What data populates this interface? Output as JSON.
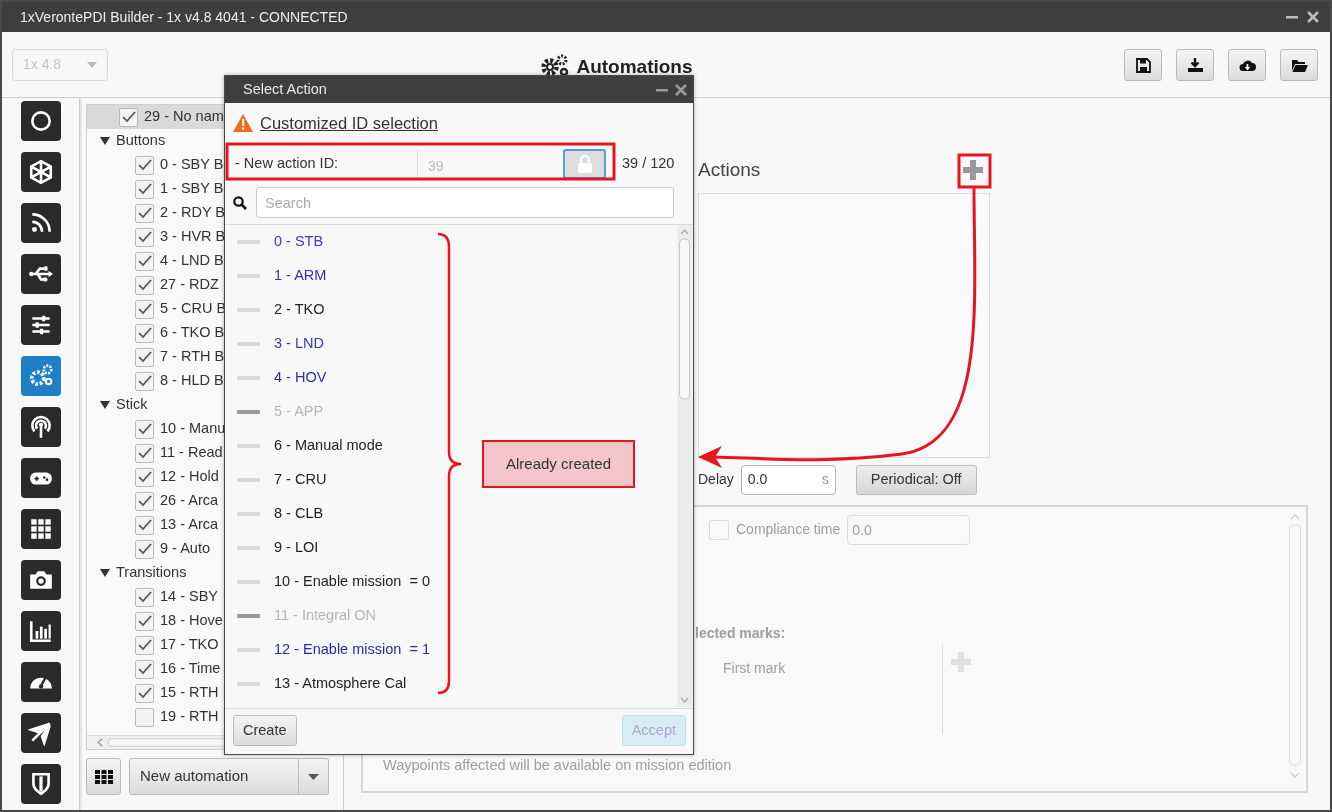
{
  "window": {
    "title": "1xVerontePDI Builder - 1x v4.8 4041 - CONNECTED"
  },
  "toolbar": {
    "version_select": {
      "value": "1x 4.8",
      "disabled": true
    },
    "title": "Automations"
  },
  "sidebar": {
    "items": [
      {
        "selected": false
      },
      {
        "selected": false
      },
      {
        "selected": false
      },
      {
        "selected": false
      },
      {
        "selected": false
      },
      {
        "selected": true
      },
      {
        "selected": false
      },
      {
        "selected": false
      },
      {
        "selected": false
      },
      {
        "selected": false
      },
      {
        "selected": false
      },
      {
        "selected": false
      },
      {
        "selected": false
      },
      {
        "selected": false
      }
    ]
  },
  "tree": {
    "items": [
      {
        "label": "29 - No nam",
        "checked": true,
        "selected": true
      },
      {
        "label": "Buttons",
        "expanded": true,
        "children": [
          {
            "label": "0 - SBY B",
            "checked": true,
            "selected": false
          },
          {
            "label": "1 - SBY B",
            "checked": true,
            "selected": false
          },
          {
            "label": "2 - RDY B",
            "checked": true,
            "selected": false
          },
          {
            "label": "3 - HVR B",
            "checked": true,
            "selected": false
          },
          {
            "label": "4 - LND B",
            "checked": true,
            "selected": false
          },
          {
            "label": "27 - RDZ",
            "checked": true,
            "selected": false
          },
          {
            "label": "5 - CRU B",
            "checked": true,
            "selected": false
          },
          {
            "label": "6 - TKO B",
            "checked": true,
            "selected": false
          },
          {
            "label": "7 - RTH B",
            "checked": true,
            "selected": false
          },
          {
            "label": "8 - HLD B",
            "checked": true,
            "selected": false
          }
        ]
      },
      {
        "label": "Stick",
        "expanded": true,
        "children": [
          {
            "label": "10 - Manu",
            "checked": true,
            "selected": false
          },
          {
            "label": "11 - Read",
            "checked": true,
            "selected": false
          },
          {
            "label": "12 - Hold",
            "checked": true,
            "selected": false
          },
          {
            "label": "26 - Arca",
            "checked": true,
            "selected": false
          },
          {
            "label": "13 - Arca",
            "checked": true,
            "selected": false
          },
          {
            "label": "9 - Auto",
            "checked": true,
            "selected": false
          }
        ]
      },
      {
        "label": "Transitions",
        "expanded": true,
        "children": [
          {
            "label": "14 - SBY",
            "checked": true,
            "selected": false
          },
          {
            "label": "18 - Hove",
            "checked": true,
            "selected": false
          },
          {
            "label": "17 - TKO",
            "checked": true,
            "selected": false
          },
          {
            "label": "16 - Time",
            "checked": true,
            "selected": false
          },
          {
            "label": "15 - RTH",
            "checked": true,
            "selected": false
          },
          {
            "label": "19 - RTH",
            "checked": false,
            "selected": false
          }
        ]
      }
    ]
  },
  "bottom_bar": {
    "automation_button": "New automation"
  },
  "actions_panel": {
    "title": "Actions",
    "delay_label": "Delay",
    "delay_value": "0.0",
    "delay_unit": "s",
    "periodical_button": "Periodical: Off"
  },
  "conditions_panel": {
    "disabled": true,
    "compliance_checked": false,
    "compliance_label": "Compliance time",
    "compliance_value": "0.0",
    "marks_label": "lected marks:",
    "first_mark": "First mark",
    "note": "Waypoints affected will be available on mission edition"
  },
  "dialog": {
    "title": "Select Action",
    "link": "Customized ID selection",
    "id_label": "- New action ID:",
    "id_value": "39",
    "id_locked": true,
    "id_count": "39 / 120",
    "search_placeholder": "Search",
    "actions": [
      {
        "label": "0 - STB",
        "color": "#3b3bb0",
        "disabled": false
      },
      {
        "label": "1 - ARM",
        "color": "#3a2ea6",
        "disabled": false
      },
      {
        "label": "2 - TKO",
        "color": "#222222",
        "disabled": false
      },
      {
        "label": "3 - LND",
        "color": "#3b3bb0",
        "disabled": false
      },
      {
        "label": "4 - HOV",
        "color": "#2f2f9a",
        "disabled": false
      },
      {
        "label": "5 - APP",
        "color": "#b5b5b5",
        "disabled": true
      },
      {
        "label": "6 - Manual mode",
        "color": "#222222",
        "disabled": false
      },
      {
        "label": "7 - CRU",
        "color": "#222222",
        "disabled": false
      },
      {
        "label": "8 - CLB",
        "color": "#222222",
        "disabled": false
      },
      {
        "label": "9 - LOI",
        "color": "#222222",
        "disabled": false
      },
      {
        "label": "10 - Enable mission  = 0",
        "color": "#222222",
        "disabled": false
      },
      {
        "label": "11 - Integral ON",
        "color": "#b5b5b5",
        "disabled": true
      },
      {
        "label": "12 - Enable mission  = 1",
        "color": "#2a2aa8",
        "disabled": false
      },
      {
        "label": "13 - Atmosphere Cal",
        "color": "#222222",
        "disabled": false
      }
    ],
    "buttons": [
      {
        "label": "Create",
        "disabled": false
      },
      {
        "label": "Accept",
        "disabled": true
      }
    ]
  },
  "annotations": {
    "callout": "Already created"
  }
}
